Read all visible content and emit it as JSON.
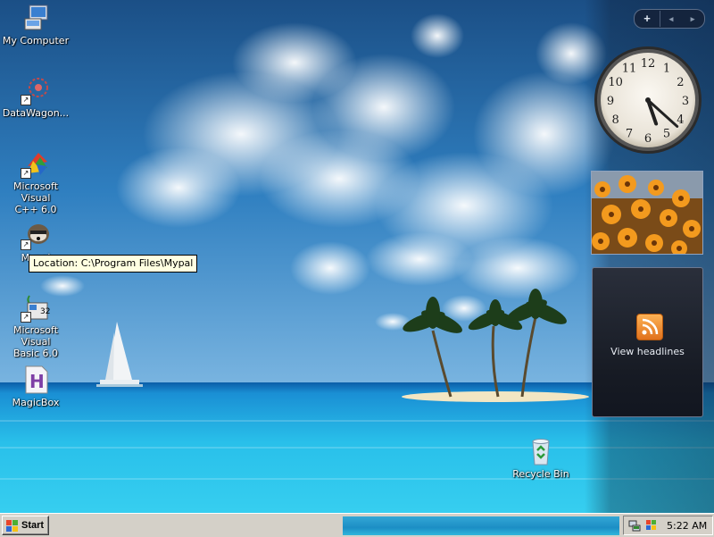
{
  "desktop": {
    "icons": [
      {
        "label": "My Computer",
        "icon": "computer-icon"
      },
      {
        "label": "DataWagon...",
        "icon": "datawagon-icon"
      },
      {
        "label": "Microsoft Visual\nC++ 6.0",
        "icon": "visual-cpp-icon"
      },
      {
        "label": "Mypal",
        "icon": "mypal-icon"
      },
      {
        "label": "Microsoft Visual\nBasic 6.0",
        "icon": "visual-basic-icon"
      },
      {
        "label": "MagicBox",
        "icon": "magicbox-icon"
      },
      {
        "label": "Recycle Bin",
        "icon": "recycle-bin-icon"
      }
    ],
    "tooltip": "Location: C:\\Program Files\\Mypal"
  },
  "sidebar": {
    "toolbar": {
      "add": "+",
      "prev": "◂",
      "next": "▸"
    },
    "clock": {
      "numbers": [
        "12",
        "1",
        "2",
        "3",
        "4",
        "5",
        "6",
        "7",
        "8",
        "9",
        "10",
        "11"
      ],
      "hour": 5,
      "minute": 22
    },
    "feed": {
      "label": "View headlines",
      "icon": "rss-icon"
    }
  },
  "taskbar": {
    "start_label": "Start",
    "clock": "5:22 AM",
    "tray_icons": [
      "network-icon",
      "security-icon"
    ]
  },
  "colors": {
    "sky_top": "#1d5f9c",
    "sea": "#2ec2e6",
    "tooltip_bg": "#ffffe1",
    "taskbar": "#d4d0c8",
    "feed_orange": "#f39530"
  }
}
